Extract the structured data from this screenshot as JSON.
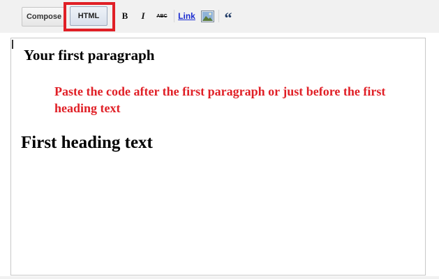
{
  "toolbar": {
    "compose_label": "Compose",
    "html_label": "HTML",
    "bold_label": "B",
    "italic_label": "I",
    "strike_label": "ABC",
    "link_label": "Link",
    "image_icon": "image-icon",
    "quote_label": "“"
  },
  "editor": {
    "paragraph": "Your first paragraph",
    "annotation": "Paste the code after the first paragraph or just before the first heading text",
    "heading": "First heading text"
  },
  "colors": {
    "highlight": "#e01f26",
    "link": "#1a2bd0",
    "toolbar_bg": "#f1f1f1"
  }
}
